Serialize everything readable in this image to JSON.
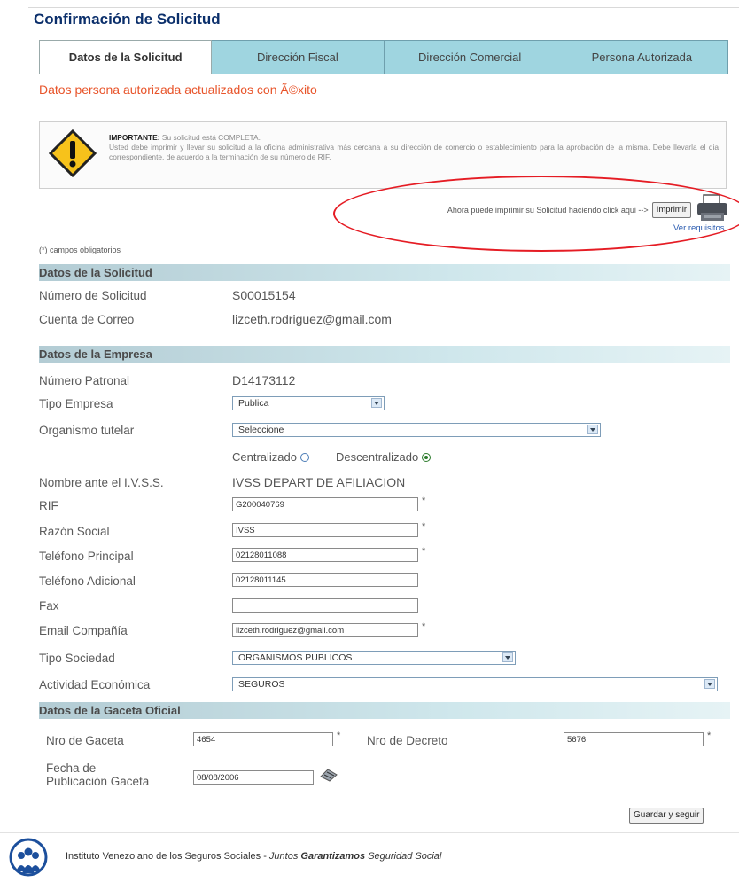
{
  "page": {
    "title": "Confirmación de Solicitud"
  },
  "tabs": [
    {
      "label": "Datos de la Solicitud",
      "active": true
    },
    {
      "label": "Dirección Fiscal",
      "active": false
    },
    {
      "label": "Dirección Comercial",
      "active": false
    },
    {
      "label": "Persona Autorizada",
      "active": false
    }
  ],
  "success_message": "Datos persona autorizada actualizados con Ã©xito",
  "notice": {
    "heading": "IMPORTANTE:",
    "status": "Su solicitud está COMPLETA.",
    "body": "Usted debe imprimir y llevar su solicitud a la oficina administrativa más cercana a su dirección de comercio o establecimiento para la aprobación de la misma. Debe llevarla el dia correspondiente, de acuerdo a la terminación de su número de RIF.",
    "icon": "warning-icon",
    "icon_color": "#f7c21b"
  },
  "print": {
    "prompt": "Ahora puede imprimir su Solicitud haciendo click aqui -->",
    "button": "Imprimir",
    "requirements_link": "Ver requisitos"
  },
  "required_note": "(*) campos obligatorios",
  "solicitud": {
    "section_title": "Datos de la Solicitud",
    "numero_label": "Número de Solicitud",
    "numero_value": "S00015154",
    "correo_label": "Cuenta de Correo",
    "correo_value": "lizceth.rodriguez@gmail.com"
  },
  "empresa": {
    "section_title": "Datos de la Empresa",
    "patronal_label": "Número Patronal",
    "patronal_value": "D14173112",
    "tipo_label": "Tipo Empresa",
    "tipo_value": "Publica",
    "organismo_label": "Organismo tutelar",
    "organismo_value": "Seleccione",
    "centralizado_label": "Centralizado",
    "descentralizado_label": "Descentralizado",
    "nombre_label": "Nombre ante el I.V.S.S.",
    "nombre_value": "IVSS DEPART DE AFILIACION",
    "rif_label": "RIF",
    "rif_value": "G200040769",
    "razon_label": "Razón Social",
    "razon_value": "IVSS",
    "tel_principal_label": "Teléfono Principal",
    "tel_principal_value": "02128011088",
    "tel_adicional_label": "Teléfono Adicional",
    "tel_adicional_value": "02128011145",
    "fax_label": "Fax",
    "fax_value": "",
    "email_label": "Email Compañía",
    "email_value": "lizceth.rodriguez@gmail.com",
    "sociedad_label": "Tipo Sociedad",
    "sociedad_value": "ORGANISMOS PUBLICOS",
    "actividad_label": "Actividad Económica",
    "actividad_value": "SEGUROS",
    "required_mark": "*"
  },
  "gaceta": {
    "section_title": "Datos de la Gaceta Oficial",
    "nro_gaceta_label": "Nro de Gaceta",
    "nro_gaceta_value": "4654",
    "nro_decreto_label": "Nro de Decreto",
    "nro_decreto_value": "5676",
    "fecha_label_1": "Fecha de",
    "fecha_label_2": "Publicación Gaceta",
    "fecha_value": "08/08/2006"
  },
  "actions": {
    "save_button": "Guardar y seguir"
  },
  "footer": {
    "institution": "Instituto Venezolano de los Seguros Sociales - ",
    "slogan_1": "Juntos ",
    "slogan_2": "Garantizamos",
    "slogan_3": " Seguridad Social",
    "logo_text": "IVSS"
  },
  "colors": {
    "accent_title": "#0b2f6b",
    "tab_bg": "#9fd5e0",
    "success": "#e8542a",
    "highlight_ellipse": "#e51c24"
  }
}
